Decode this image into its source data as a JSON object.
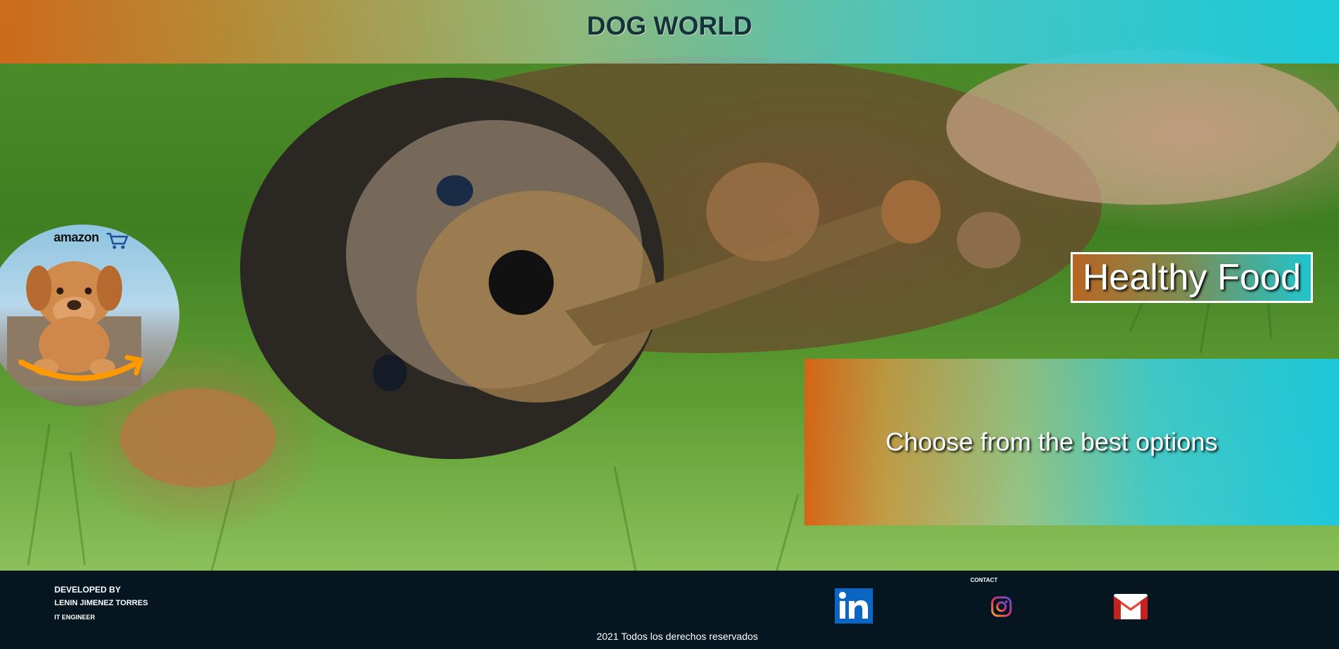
{
  "header": {
    "title": "DOG WORLD"
  },
  "promo": {
    "amazon_logo_text": "amazon",
    "headline": "Healthy Food",
    "tagline": "Choose from the best options"
  },
  "footer": {
    "developed_by_label": "DEVELOPED BY",
    "developer_name": "LENIN JIMENEZ TORRES",
    "developer_role": "IT ENGINEER",
    "contact_label": "CONTACT",
    "copyright": "2021 Todos los derechos reservados",
    "social_icons": [
      "linkedin-icon",
      "instagram-icon",
      "gmail-icon"
    ]
  },
  "colors": {
    "header_gradient_start": "#d6681a",
    "header_gradient_end": "#19cde1",
    "title_text": "#12343a",
    "footer_background": "#061620",
    "linkedin_blue": "#0a66c2",
    "gmail_red": "#ea4335",
    "amazon_orange": "#ff9900"
  }
}
